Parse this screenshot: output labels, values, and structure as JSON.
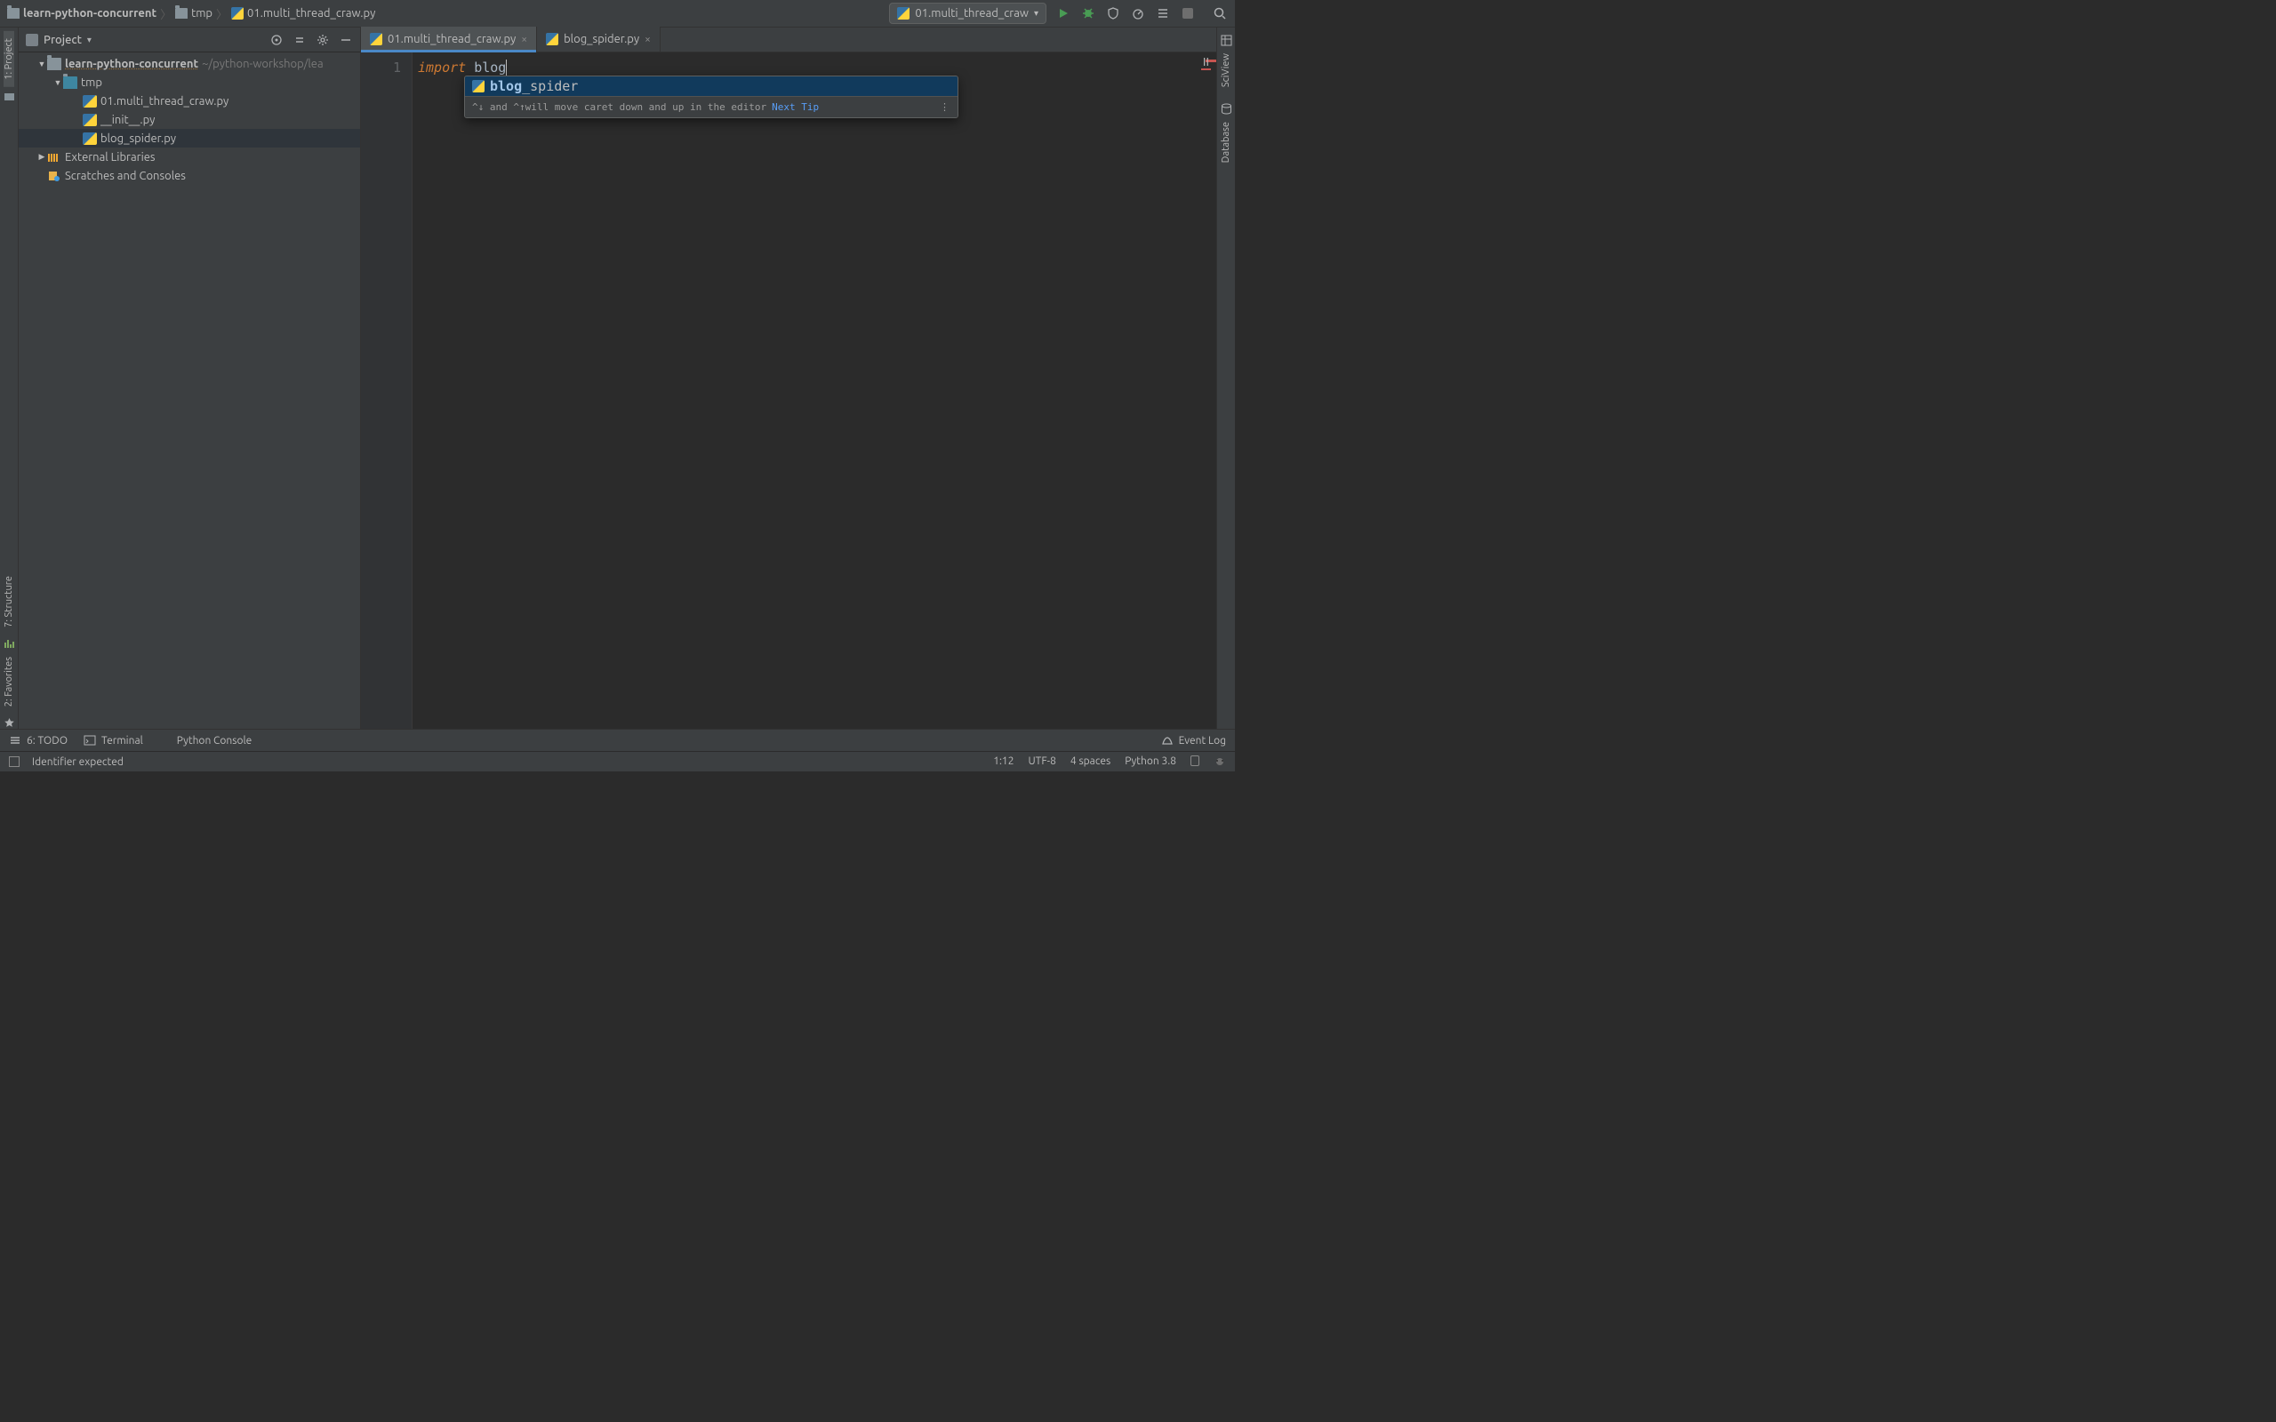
{
  "breadcrumb": {
    "root": "learn-python-concurrent",
    "dir": "tmp",
    "file": "01.multi_thread_craw.py"
  },
  "runConfig": {
    "name": "01.multi_thread_craw"
  },
  "project": {
    "title": "Project",
    "root": {
      "name": "learn-python-concurrent",
      "path": "~/python-workshop/lea"
    },
    "tmp": "tmp",
    "files": {
      "f1": "01.multi_thread_craw.py",
      "f2": "__init__.py",
      "f3": "blog_spider.py"
    },
    "extlib": "External Libraries",
    "scratch": "Scratches and Consoles"
  },
  "tabs": {
    "t1": "01.multi_thread_craw.py",
    "t2": "blog_spider.py"
  },
  "sideTools": {
    "project": "1: Project",
    "structure": "7: Structure",
    "favorites": "2: Favorites",
    "sciview": "SciView",
    "database": "Database"
  },
  "editor": {
    "lineNo": "1",
    "kw": "import",
    "ident": " blog"
  },
  "completion": {
    "match": "blog",
    "rest": "_spider",
    "tipPrefix": "^↓ and ^↑ ",
    "tipText": "will move caret down and up in the editor",
    "next": "Next Tip"
  },
  "bottom": {
    "todo": "6: TODO",
    "terminal": "Terminal",
    "pyconsole": "Python Console",
    "eventlog": "Event Log"
  },
  "status": {
    "msg": "Identifier expected",
    "pos": "1:12",
    "enc": "UTF-8",
    "indent": "4 spaces",
    "python": "Python 3.8"
  }
}
